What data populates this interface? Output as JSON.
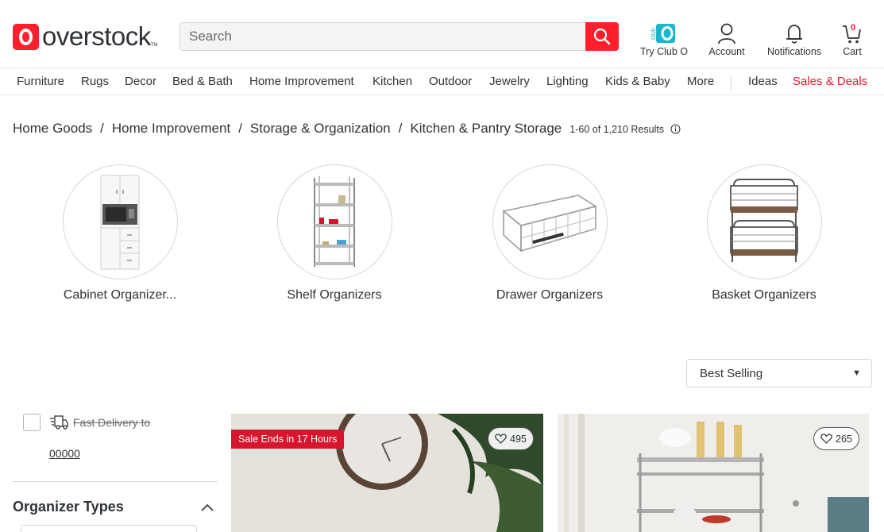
{
  "header": {
    "logo_text": "overstock",
    "logo_tm": "TM",
    "search_placeholder": "Search",
    "actions": {
      "club_o": "Try Club O",
      "account": "Account",
      "notifications": "Notifications",
      "cart": "Cart",
      "cart_count": "0"
    }
  },
  "nav": {
    "items": [
      "Furniture",
      "Rugs",
      "Decor",
      "Bed & Bath",
      "Home Improvement",
      "Kitchen",
      "Outdoor",
      "Jewelry",
      "Lighting",
      "Kids & Baby",
      "More",
      "Ideas",
      "Sales & Deals"
    ]
  },
  "breadcrumb": {
    "items": [
      "Home Goods",
      "Home Improvement",
      "Storage & Organization",
      "Kitchen & Pantry Storage"
    ],
    "separator": "/",
    "results": "1-60 of 1,210 Results"
  },
  "categories": [
    {
      "label": "Cabinet Organizer..."
    },
    {
      "label": "Shelf Organizers"
    },
    {
      "label": "Drawer Organizers"
    },
    {
      "label": "Basket Organizers"
    }
  ],
  "sort": {
    "selected": "Best Selling"
  },
  "sidebar": {
    "fast_delivery_label": "Fast Delivery to",
    "zip": "00000",
    "organizer_types_title": "Organizer Types"
  },
  "products": [
    {
      "badge": "Sale Ends in 17 Hours",
      "favorites": "495"
    },
    {
      "favorites": "265"
    }
  ],
  "colors": {
    "brand_red": "#ff1f2c",
    "sale_red": "#d7152c",
    "deals_red": "#e4182a",
    "club_teal": "#1ab6c9",
    "text": "#2f3337"
  }
}
